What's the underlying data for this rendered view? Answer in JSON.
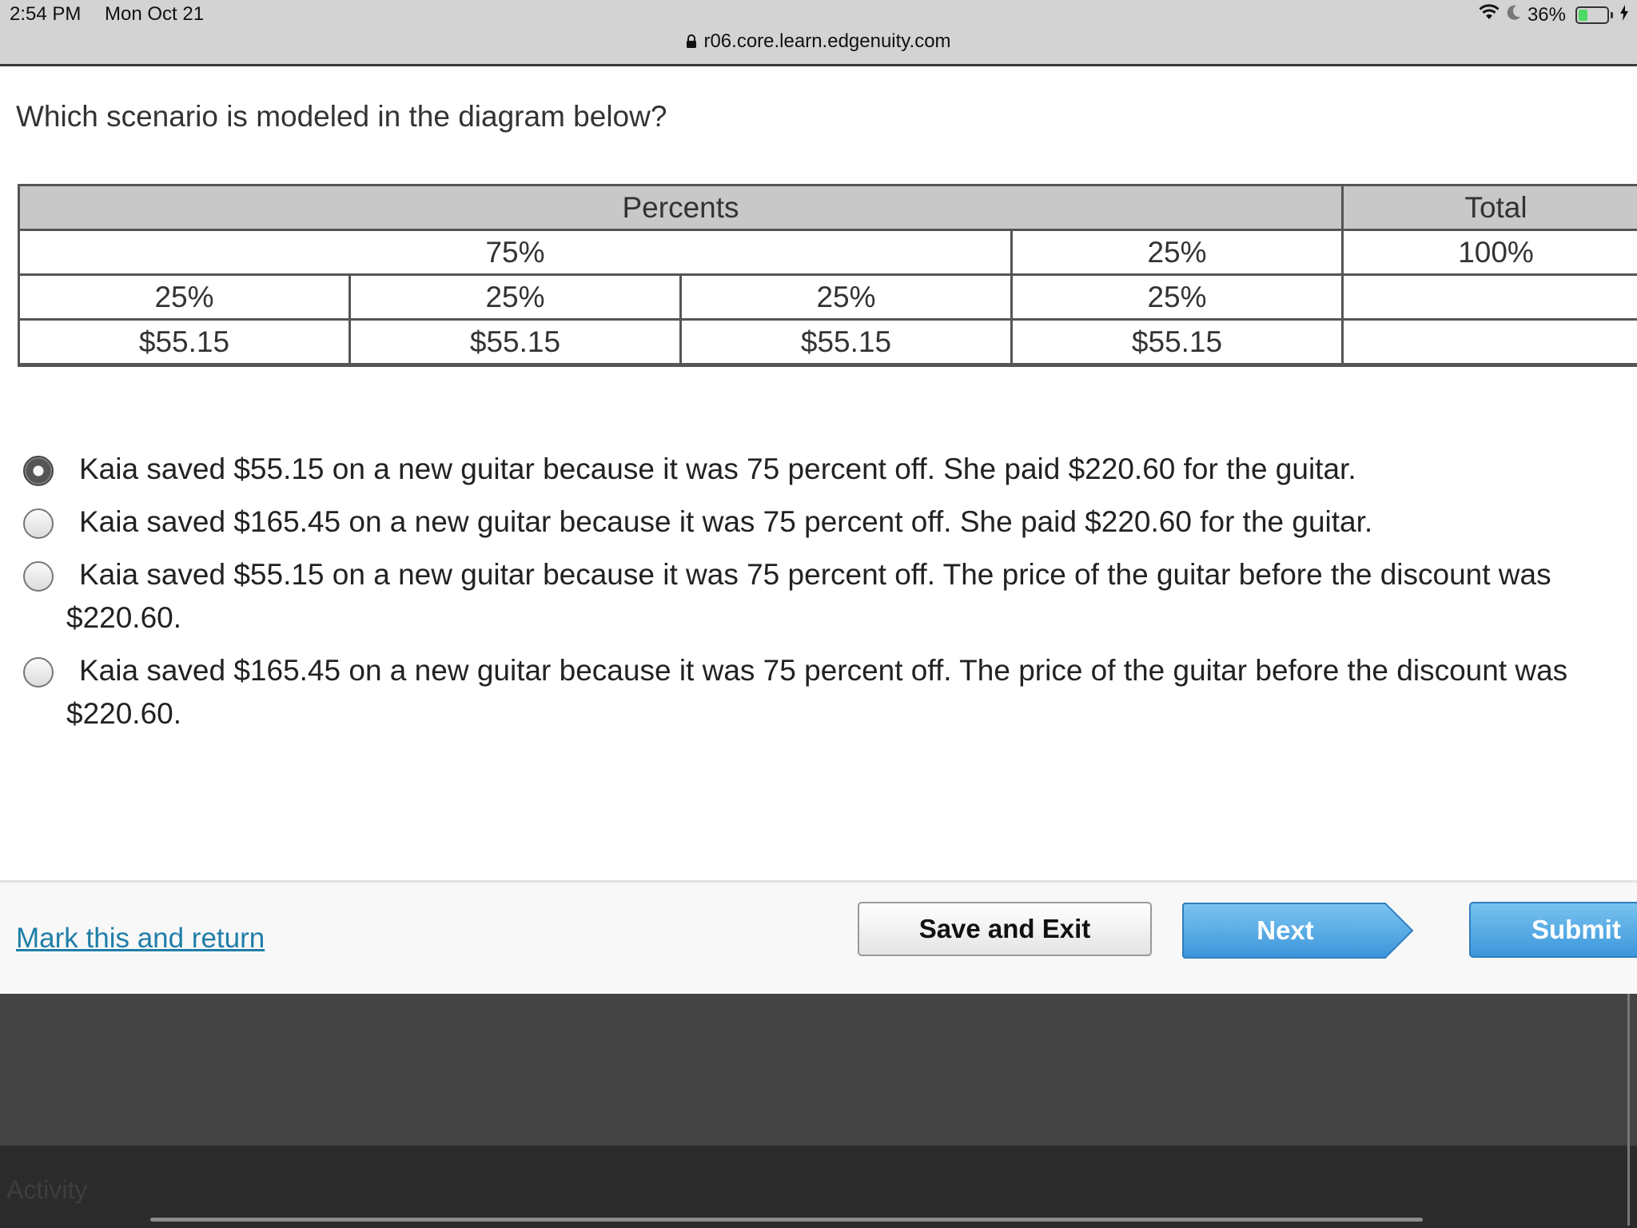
{
  "status_bar": {
    "time": "2:54 PM",
    "date": "Mon Oct 21",
    "url": "r06.core.learn.edgenuity.com",
    "battery": "36%",
    "battery_level": 0.36
  },
  "question": {
    "text": "Which scenario is modeled in the diagram below?"
  },
  "table": {
    "header": {
      "percents": "Percents",
      "total": "Total"
    },
    "row2": {
      "seventy_five": "75%",
      "twenty_five": "25%",
      "hundred": "100%"
    },
    "row3": [
      "25%",
      "25%",
      "25%",
      "25%",
      ""
    ],
    "row4": [
      "$55.15",
      "$55.15",
      "$55.15",
      "$55.15",
      ""
    ]
  },
  "options": [
    {
      "line1": "Kaia saved $55.15 on a new guitar because it was 75 percent off. She paid $220.60 for the guitar.",
      "line2": "",
      "selected": true
    },
    {
      "line1": "Kaia saved $165.45 on a new guitar because it was 75 percent off. She paid $220.60 for the guitar.",
      "line2": "",
      "selected": false
    },
    {
      "line1": "Kaia saved $55.15 on a new guitar because it was 75 percent off. The price of the guitar before the discount was",
      "line2": "$220.60.",
      "selected": false
    },
    {
      "line1": "Kaia saved $165.45 on a new guitar because it was 75 percent off. The price of the guitar before the discount was",
      "line2": "$220.60.",
      "selected": false
    }
  ],
  "footer": {
    "mark_link": "Mark this and return",
    "save_exit": "Save and Exit",
    "next": "Next",
    "submit": "Submit"
  },
  "bottom": {
    "activity": "Activity"
  },
  "colors": {
    "link": "#1f7ea8",
    "primary_button": "#4ba3e3",
    "battery_fill": "#4cd964"
  }
}
